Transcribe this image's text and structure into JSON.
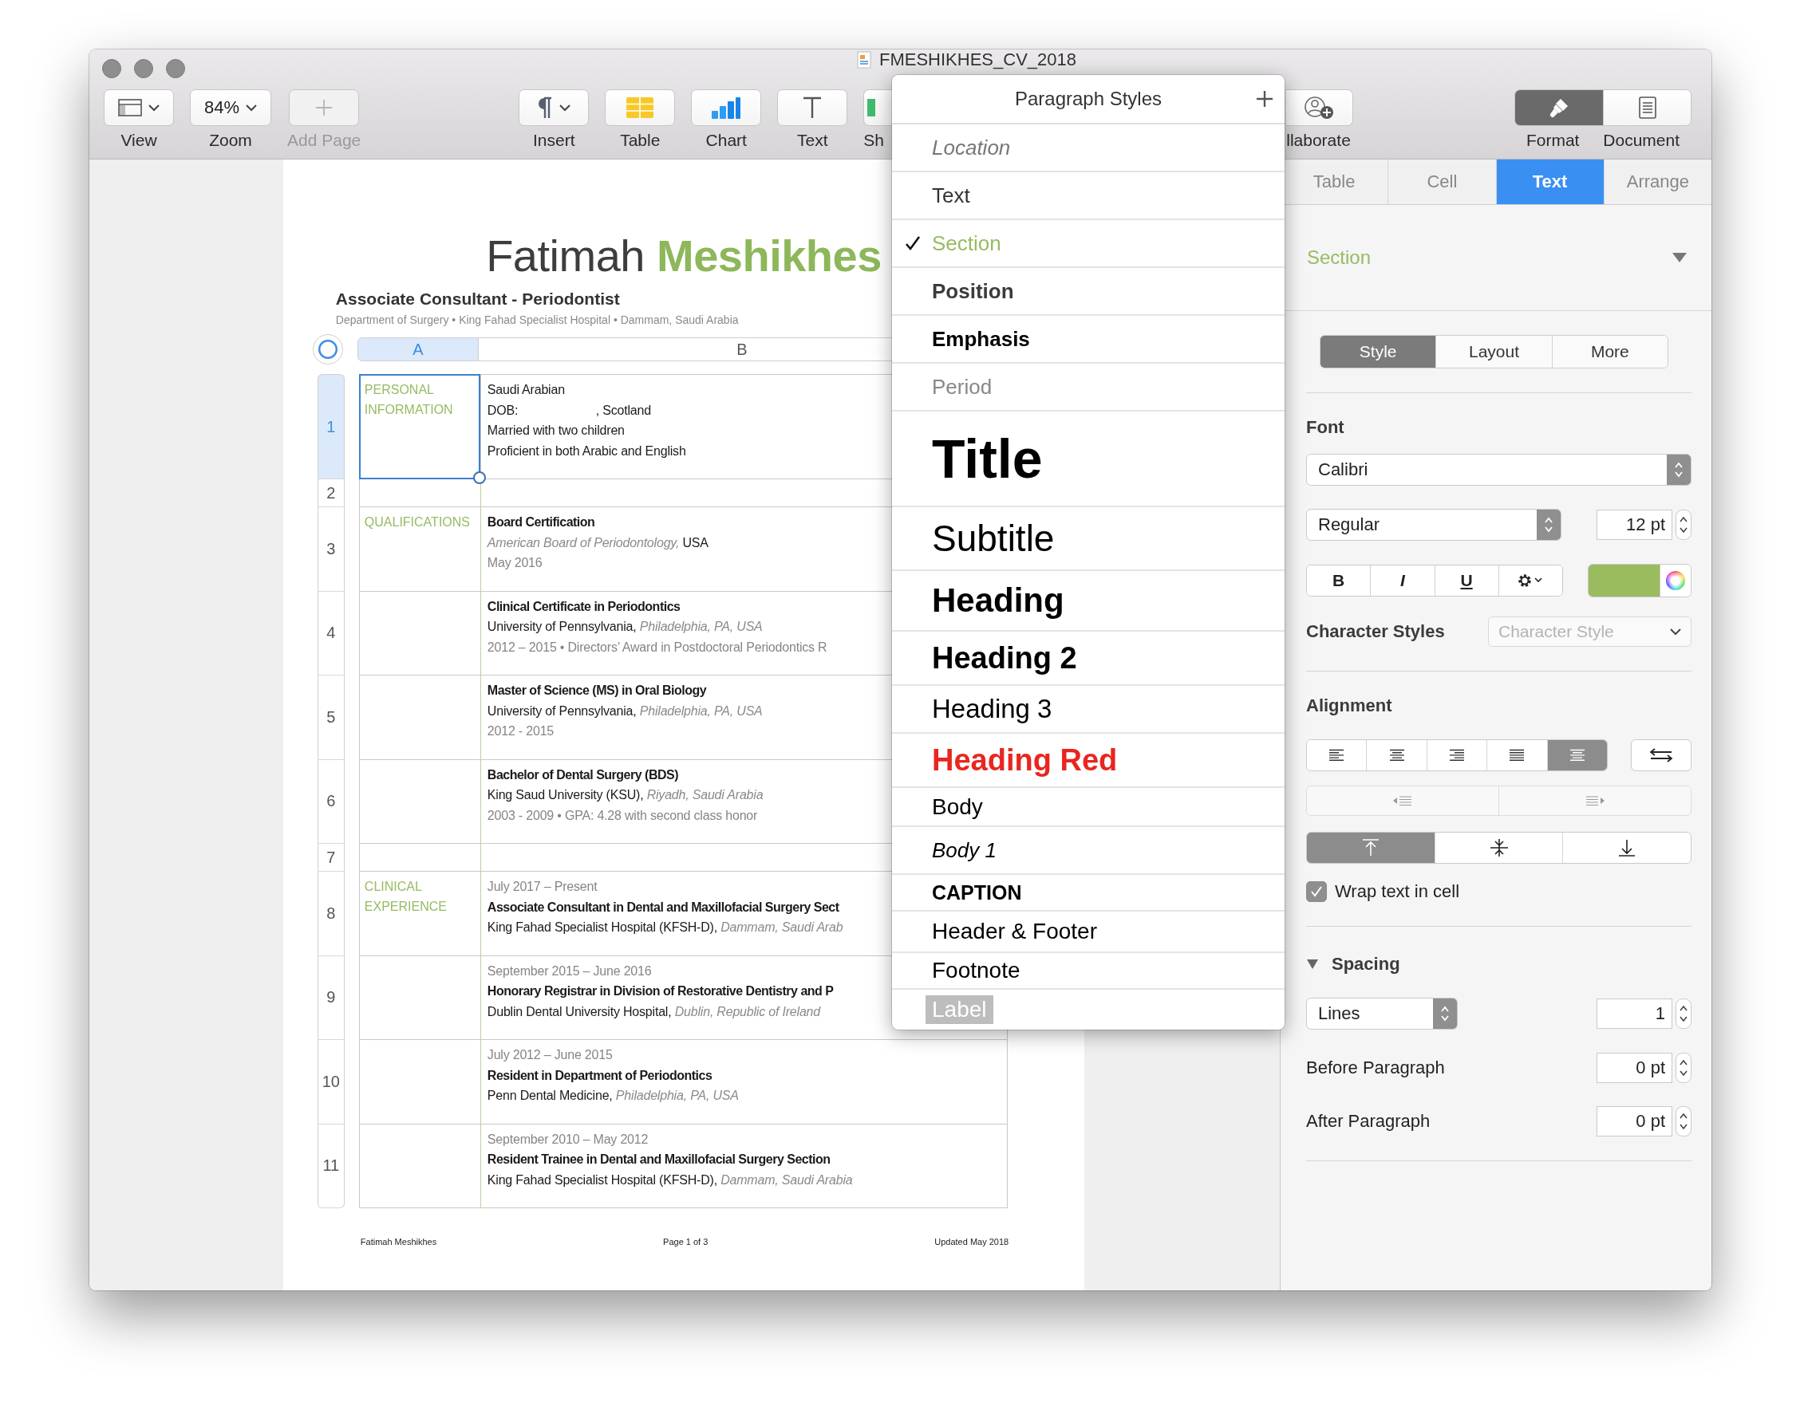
{
  "window": {
    "title": "FMESHIKHES_CV_2018"
  },
  "toolbar": {
    "left": [
      {
        "kind": "view",
        "label": "View",
        "disabled": false
      },
      {
        "kind": "zoom",
        "label": "Zoom",
        "value": "84%",
        "disabled": false
      },
      {
        "kind": "add-page",
        "label": "Add Page",
        "disabled": true
      }
    ],
    "center": [
      {
        "kind": "insert",
        "label": "Insert",
        "disabled": false
      },
      {
        "kind": "table",
        "label": "Table",
        "disabled": false
      },
      {
        "kind": "chart",
        "label": "Chart",
        "disabled": false
      },
      {
        "kind": "text",
        "label": "Text",
        "disabled": false
      },
      {
        "kind": "shape",
        "label": "Sh",
        "disabled": false
      }
    ],
    "collaborate": {
      "label": "llaborate"
    },
    "views": [
      {
        "kind": "format",
        "label": "Format",
        "selected": true
      },
      {
        "kind": "document",
        "label": "Document",
        "selected": false
      }
    ]
  },
  "document": {
    "name": "Fatimah **Meshikhes**",
    "position": "Associate Consultant - Periodontist",
    "contact": "Department of Surgery • King Fahad Specialist Hospital • Dammam, Saudi Arabia",
    "table": {
      "columns": [
        {
          "label": "A",
          "selected": true
        },
        {
          "label": "B",
          "selected": false
        }
      ],
      "rows": [
        {
          "number": "1",
          "selected": true,
          "section": "PERSONAL INFORMATION",
          "lines": [
            {
              "kind": "body",
              "text": "Saudi Arabian"
            },
            {
              "kind": "body",
              "text": "DOB:                       , Scotland"
            },
            {
              "kind": "body",
              "text": "Married with two children"
            },
            {
              "kind": "body",
              "text": "Proficient in both Arabic and English"
            }
          ]
        },
        {
          "number": "2",
          "selected": false
        },
        {
          "number": "3",
          "selected": false,
          "section": "QUALIFICATIONS",
          "lines": [
            {
              "kind": "title",
              "text": "Board Certification"
            },
            {
              "kind": "body",
              "text": "*American Board of Periodontology,* USA"
            },
            {
              "kind": "meta",
              "text": "May 2016"
            }
          ]
        },
        {
          "number": "4",
          "selected": false,
          "lines": [
            {
              "kind": "title",
              "text": "Clinical Certificate in Periodontics"
            },
            {
              "kind": "body",
              "text": "University of Pennsylvania, *Philadelphia, PA, USA*"
            },
            {
              "kind": "meta",
              "text": "2012 – 2015 • Directors’ Award in Postdoctoral Periodontics R"
            }
          ]
        },
        {
          "number": "5",
          "selected": false,
          "lines": [
            {
              "kind": "title",
              "text": "Master of Science (MS) in Oral Biology"
            },
            {
              "kind": "body",
              "text": "University of Pennsylvania, *Philadelphia, PA, USA*"
            },
            {
              "kind": "meta",
              "text": "2012 - 2015"
            }
          ]
        },
        {
          "number": "6",
          "selected": false,
          "lines": [
            {
              "kind": "title",
              "text": "Bachelor of Dental Surgery (BDS)"
            },
            {
              "kind": "body",
              "text": "King Saud University (KSU), *Riyadh, Saudi Arabia*"
            },
            {
              "kind": "meta",
              "text": "2003 - 2009 • GPA: 4.28 with second class honor"
            }
          ]
        },
        {
          "number": "7",
          "selected": false
        },
        {
          "number": "8",
          "selected": false,
          "section": "CLINICAL EXPERIENCE",
          "lines": [
            {
              "kind": "meta",
              "text": "July 2017 – Present"
            },
            {
              "kind": "title",
              "text": "Associate Consultant in Dental and Maxillofacial Surgery Sect"
            },
            {
              "kind": "body",
              "text": "King Fahad Specialist Hospital (KFSH-D), *Dammam, Saudi Arab*"
            }
          ]
        },
        {
          "number": "9",
          "selected": false,
          "lines": [
            {
              "kind": "meta",
              "text": "September 2015 – June 2016"
            },
            {
              "kind": "title",
              "text": "Honorary Registrar in Division of Restorative Dentistry and P"
            },
            {
              "kind": "body",
              "text": "Dublin Dental University Hospital, *Dublin, Republic of Ireland*"
            }
          ]
        },
        {
          "number": "10",
          "selected": false,
          "lines": [
            {
              "kind": "meta",
              "text": "July 2012 – June 2015"
            },
            {
              "kind": "title",
              "text": "Resident in Department of Periodontics"
            },
            {
              "kind": "body",
              "text": "Penn Dental Medicine, *Philadelphia, PA, USA*"
            }
          ]
        },
        {
          "number": "11",
          "selected": false,
          "lines": [
            {
              "kind": "meta",
              "text": "September 2010 – May 2012"
            },
            {
              "kind": "title",
              "text": "Resident Trainee in Dental and Maxillofacial Surgery Section"
            },
            {
              "kind": "body",
              "text": "King Fahad Specialist Hospital (KFSH-D), *Dammam, Saudi Arabia*"
            }
          ]
        }
      ]
    },
    "footer": {
      "left": "Fatimah Meshikhes",
      "center": "Page 1 of 3",
      "right": "Updated May 2018"
    }
  },
  "popup": {
    "title": "Paragraph Styles",
    "items": [
      {
        "kind": "location",
        "label": "Location",
        "selected": false
      },
      {
        "kind": "text",
        "label": "Text",
        "selected": false
      },
      {
        "kind": "section",
        "label": "Section",
        "selected": true
      },
      {
        "kind": "position",
        "label": "Position",
        "selected": false
      },
      {
        "kind": "emphasis",
        "label": "Emphasis",
        "selected": false
      },
      {
        "kind": "period",
        "label": "Period",
        "selected": false
      },
      {
        "kind": "title",
        "label": "Title",
        "selected": false
      },
      {
        "kind": "subtitle",
        "label": "Subtitle",
        "selected": false
      },
      {
        "kind": "heading",
        "label": "Heading",
        "selected": false
      },
      {
        "kind": "heading2",
        "label": "Heading 2",
        "selected": false
      },
      {
        "kind": "heading3",
        "label": "Heading 3",
        "selected": false
      },
      {
        "kind": "heading-red",
        "label": "Heading Red",
        "selected": false
      },
      {
        "kind": "body",
        "label": "Body",
        "selected": false
      },
      {
        "kind": "body1",
        "label": "Body 1",
        "selected": false
      },
      {
        "kind": "caption",
        "label": "CAPTION",
        "selected": false
      },
      {
        "kind": "header-footer",
        "label": "Header & Footer",
        "selected": false
      },
      {
        "kind": "footnote",
        "label": "Footnote",
        "selected": false
      },
      {
        "kind": "label",
        "label": "Label",
        "selected": false
      }
    ]
  },
  "inspector": {
    "tabs": [
      {
        "label": "Table",
        "selected": false
      },
      {
        "label": "Cell",
        "selected": false
      },
      {
        "label": "Text",
        "selected": true
      },
      {
        "label": "Arrange",
        "selected": false
      }
    ],
    "paragraph_style": "Section",
    "subtabs": [
      {
        "label": "Style",
        "selected": true
      },
      {
        "label": "Layout",
        "selected": false
      },
      {
        "label": "More",
        "selected": false
      }
    ],
    "font": {
      "heading": "Font",
      "family": "Calibri",
      "typeface": "Regular",
      "size": "12 pt",
      "color": "#9bbb5f"
    },
    "format_buttons": [
      {
        "kind": "bold",
        "label": "B"
      },
      {
        "kind": "italic",
        "label": "I"
      },
      {
        "kind": "underline",
        "label": "U"
      },
      {
        "kind": "gear"
      }
    ],
    "character_styles": {
      "label": "Character Styles",
      "placeholder": "Character Style"
    },
    "alignment": {
      "heading": "Alignment",
      "buttons": [
        {
          "kind": "left",
          "selected": false
        },
        {
          "kind": "center",
          "selected": false
        },
        {
          "kind": "right",
          "selected": false
        },
        {
          "kind": "justify",
          "selected": false
        },
        {
          "kind": "auto",
          "selected": true
        }
      ],
      "vertical": [
        {
          "kind": "top",
          "selected": true
        },
        {
          "kind": "middle",
          "selected": false
        },
        {
          "kind": "bottom",
          "selected": false
        }
      ]
    },
    "wrap": {
      "label": "Wrap text in cell",
      "checked": true
    },
    "spacing": {
      "label": "Spacing",
      "expanded": true,
      "mode": "Lines",
      "value": "1",
      "before_label": "Before Paragraph",
      "before": "0 pt",
      "after_label": "After Paragraph",
      "after": "0 pt"
    }
  }
}
